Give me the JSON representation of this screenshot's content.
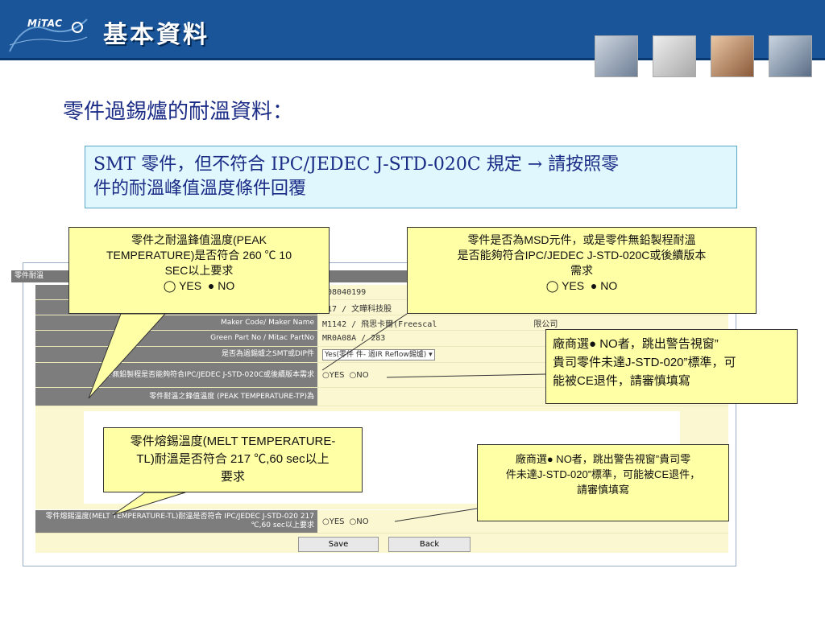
{
  "header": {
    "logo_text": "MiTAC",
    "title": "基本資料"
  },
  "section_title": "零件過錫爐的耐溫資料：",
  "info_box": {
    "line1": "SMT 零件，但不符合 IPC/JEDEC J-STD-020C 規定 → 請按照零",
    "line2": "件的耐溫峰值溫度條件回覆"
  },
  "form": {
    "panel_title": "零件耐溫",
    "rows": [
      {
        "label": "",
        "value": "008040199"
      },
      {
        "label": "",
        "value": "217 / 文曄科技股"
      },
      {
        "label": "Maker Code/ Maker Name",
        "value": "M1142 / 飛思卡爾(Freescal"
      },
      {
        "label": "Green Part No / Mitac PartNo",
        "value": "MR0A08A / 283"
      },
      {
        "label": "是否為過錫爐之SMT或DIP件",
        "value": "Yes(零件"
      },
      {
        "label": "零件無鉛製程是否能夠符合IPC/JEDEC J-STD-020C或後續版本需求",
        "value": ""
      },
      {
        "label": "零件耐溫之鋒值溫度 (PEAK TEMPERATURE-TP)為",
        "value": ""
      },
      {
        "label": "零件熔錫溫度(MELT TEMPERATURE-TL)耐溫是否符合 IPC/JEDEC J-STD-020 217 ℃,60 sec以上要求",
        "value": ""
      }
    ],
    "dropdown_value": "Yes(零件  件- 過IR Reflow錫爐)",
    "maker_suffix": "限公司",
    "yes_label": "YES",
    "no_label": "NO",
    "save_label": "Save",
    "back_label": "Back"
  },
  "callouts": {
    "peak": {
      "line1": "零件之耐溫鋒值溫度(PEAK",
      "line2": "TEMPERATURE)是否符合 260 ℃ 10",
      "line3": "SEC以上要求",
      "yes": "◯ YES",
      "no": "● NO"
    },
    "msd": {
      "line1": "零件是否為MSD元件，或是零件無鉛製程耐溫",
      "line2": "是否能夠符合IPC/JEDEC J-STD-020C或後續版本",
      "line3": "需求",
      "yes": "◯ YES",
      "no": "● NO"
    },
    "warn1": {
      "line1": "廠商選● NO者，跳出警告視窗”",
      "line2": "貴司零件未達J-STD-020”標準，可",
      "line3": "能被CE退件，請審慎填寫"
    },
    "melt": {
      "line1": "零件熔錫溫度(MELT TEMPERATURE-",
      "line2": "TL)耐溫是否符合 217 ℃,60 sec以上",
      "line3": "要求"
    },
    "warn2": {
      "line1": "廠商選● NO者，跳出警告視窗”貴司零",
      "line2": "件未達J-STD-020”標準，可能被CE退件，",
      "line3": "請審慎填寫"
    }
  },
  "colors": {
    "header_blue": "#1a5599",
    "callout_yellow": "#ffffa6",
    "info_box_bg": "#dff7fd",
    "title_navy": "#1a2b86"
  }
}
